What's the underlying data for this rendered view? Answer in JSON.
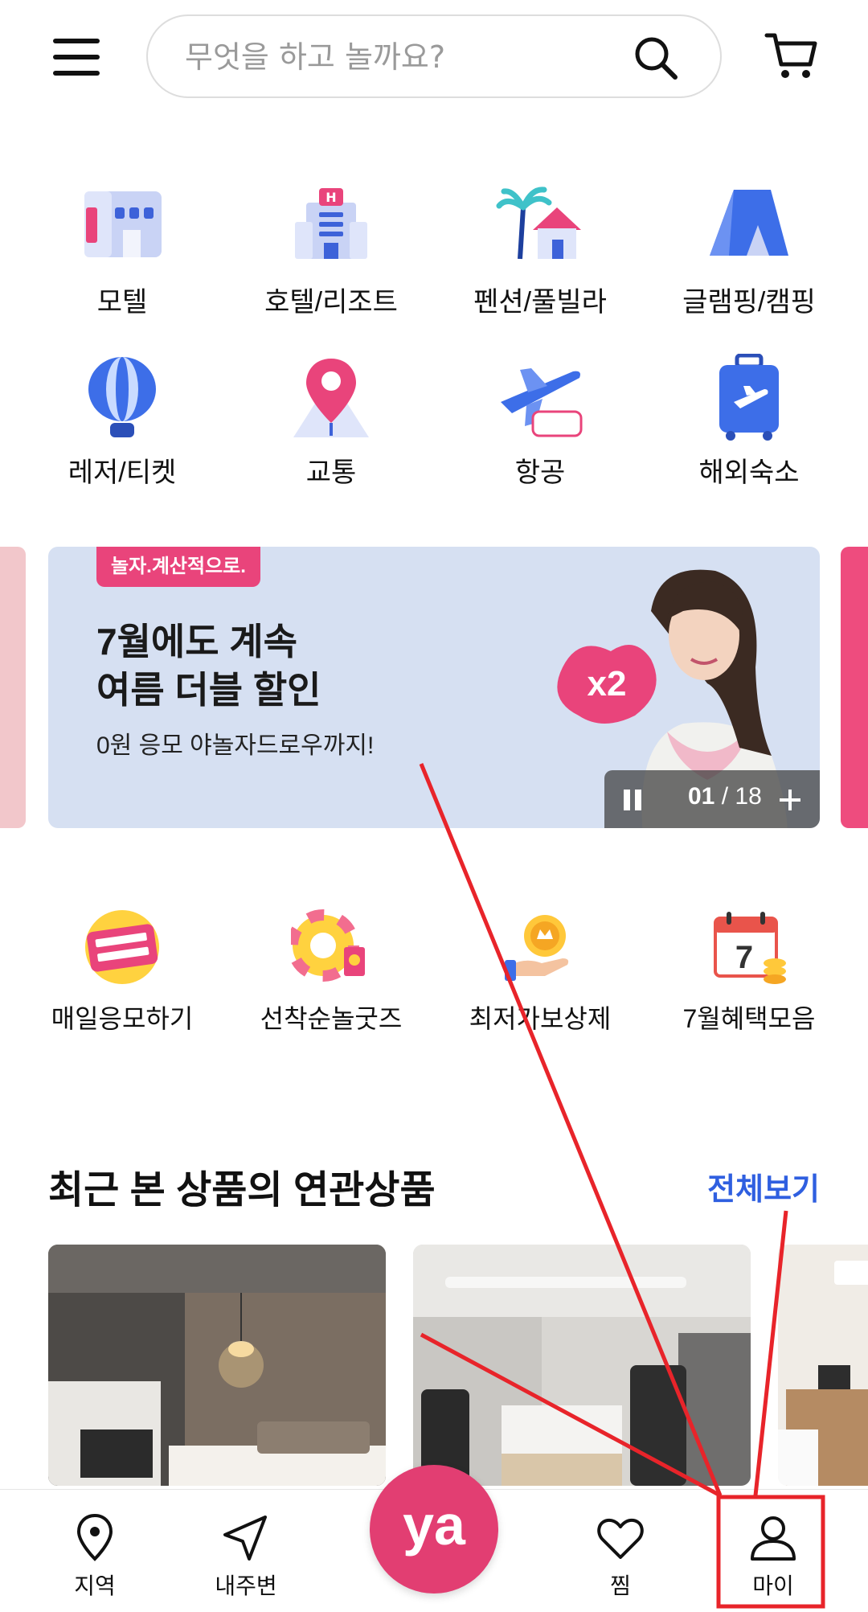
{
  "header": {
    "search_placeholder": "무엇을 하고 놀까요?"
  },
  "categories": [
    {
      "label": "모텔",
      "icon": "motel-icon"
    },
    {
      "label": "호텔/리조트",
      "icon": "hotel-icon"
    },
    {
      "label": "펜션/풀빌라",
      "icon": "pension-icon"
    },
    {
      "label": "글램핑/캠핑",
      "icon": "tent-icon"
    },
    {
      "label": "레저/티켓",
      "icon": "balloon-icon"
    },
    {
      "label": "교통",
      "icon": "map-pin-icon"
    },
    {
      "label": "항공",
      "icon": "airplane-icon"
    },
    {
      "label": "해외숙소",
      "icon": "suitcase-icon"
    }
  ],
  "banner": {
    "tag": "놀자.계산적으로.",
    "title_line1": "7월에도 계속",
    "title_line2": "여름 더블 할인",
    "subtitle": "0원 응모 야놀자드로우까지!",
    "badge": "x2",
    "current": "01",
    "separator": "/",
    "total": "18"
  },
  "events": [
    {
      "label": "매일응모하기",
      "icon": "draw-event-icon"
    },
    {
      "label": "선착순놀굿즈",
      "icon": "tube-goods-icon"
    },
    {
      "label": "최저가보상제",
      "icon": "coin-hand-icon"
    },
    {
      "label": "7월혜택모음",
      "icon": "calendar-icon"
    }
  ],
  "section": {
    "title": "최근 본 상품의 연관상품",
    "more_label": "전체보기"
  },
  "bottom_nav": {
    "items": [
      {
        "label": "지역",
        "icon": "location-pin-icon"
      },
      {
        "label": "내주변",
        "icon": "navigation-arrow-icon"
      },
      {
        "label": "찜",
        "icon": "heart-icon"
      },
      {
        "label": "마이",
        "icon": "person-icon"
      }
    ],
    "center_label": "ya"
  },
  "colors": {
    "brand_pink": "#e23e72",
    "link_blue": "#2f5fe0",
    "annotation_red": "#e8242a"
  }
}
